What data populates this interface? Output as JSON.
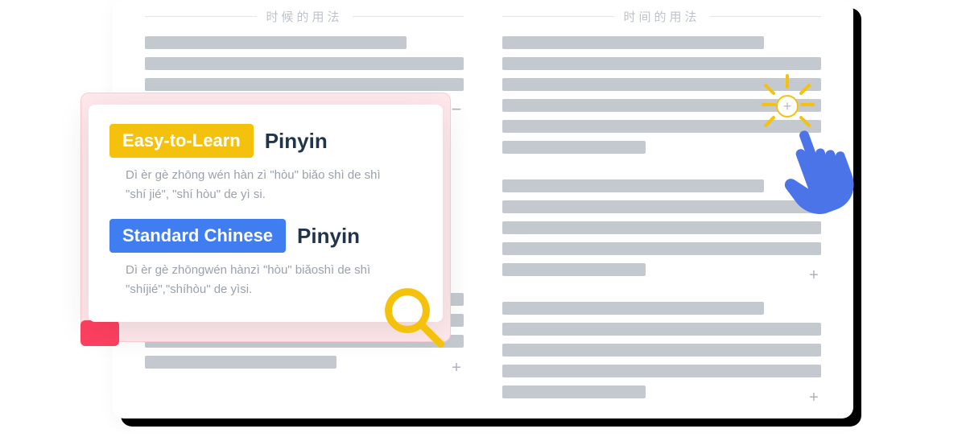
{
  "columns": {
    "left": {
      "heading": "时候的用法"
    },
    "right": {
      "heading": "时间的用法"
    }
  },
  "popup": {
    "easy": {
      "badge": "Easy-to-Learn",
      "label": "Pinyin",
      "text": "Dì èr gè zhōng wén hàn zì \"hòu\" biǎo shì de shì \"shí jié\", \"shí hòu\" de yì si."
    },
    "standard": {
      "badge": "Standard Chinese",
      "label": "Pinyin",
      "text": "Dì èr gè zhōngwén hànzì \"hòu\" biǎoshì de shì \"shíjié\",\"shíhòu\" de yìsi."
    }
  },
  "icons": {
    "plus": "+",
    "minus": "−"
  },
  "colors": {
    "yellow": "#f4c20d",
    "blue": "#3f7df0",
    "pink": "#ff4060",
    "skeleton": "#c4c9d0"
  }
}
